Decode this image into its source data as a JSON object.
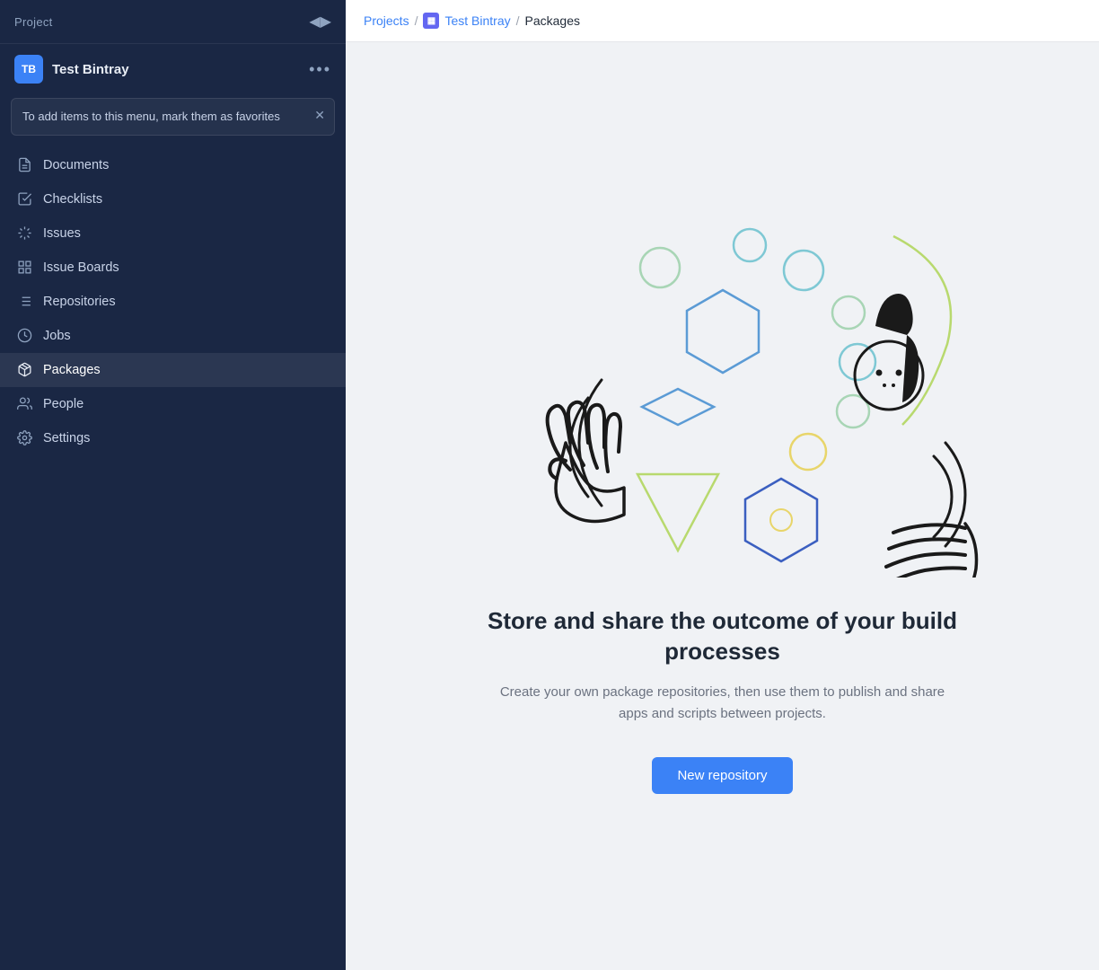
{
  "sidebar": {
    "header": {
      "title": "Project",
      "collapse_icon": "◀▶"
    },
    "project": {
      "avatar_initials": "TB",
      "name": "Test Bintray",
      "more_icon": "•••"
    },
    "tooltip": {
      "text": "To add items to this menu, mark them as favorites",
      "close_icon": "✕"
    },
    "nav": [
      {
        "id": "documents",
        "label": "Documents",
        "icon": "doc"
      },
      {
        "id": "checklists",
        "label": "Checklists",
        "icon": "check"
      },
      {
        "id": "issues",
        "label": "Issues",
        "icon": "asterisk"
      },
      {
        "id": "issue-boards",
        "label": "Issue Boards",
        "icon": "board"
      },
      {
        "id": "repositories",
        "label": "Repositories",
        "icon": "repo"
      },
      {
        "id": "jobs",
        "label": "Jobs",
        "icon": "clock"
      },
      {
        "id": "packages",
        "label": "Packages",
        "icon": "package",
        "active": true
      },
      {
        "id": "people",
        "label": "People",
        "icon": "people"
      },
      {
        "id": "settings",
        "label": "Settings",
        "icon": "gear"
      }
    ]
  },
  "breadcrumb": {
    "projects_label": "Projects",
    "group_label": "Test Bintray",
    "current_label": "Packages"
  },
  "main": {
    "headline": "Store and share the outcome of your build processes",
    "subtext": "Create your own package repositories, then use them to publish and share apps and scripts between projects.",
    "new_repo_button": "New repository"
  }
}
